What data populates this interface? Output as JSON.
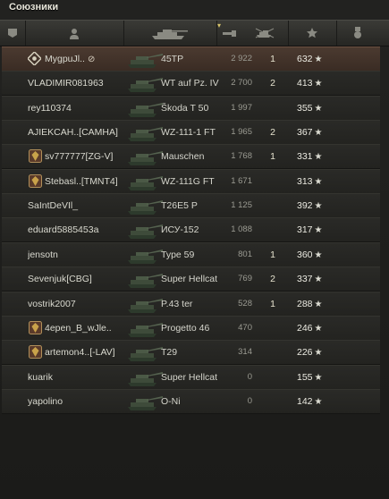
{
  "panel": {
    "title": "Союзники"
  },
  "header": {
    "icons": [
      "platoon-icon",
      "player-icon",
      "tank-icon",
      "sort-arrow-icon",
      "damage-icon",
      "kills-icon",
      "xp-star-icon",
      "medal-icon"
    ]
  },
  "players": [
    {
      "name": "MygpuJl..",
      "tank": "45TP",
      "damage": "2 922",
      "kills": "1",
      "xp": "632",
      "highlight": true,
      "dead": true,
      "icon": "platoon-icon"
    },
    {
      "name": "VLADIMIR081963",
      "tank": "WT auf Pz. IV",
      "damage": "2 700",
      "kills": "2",
      "xp": "413"
    },
    {
      "name": "rey110374",
      "tank": "Škoda T 50",
      "damage": "1 997",
      "kills": "",
      "xp": "355"
    },
    {
      "name": "AJIEKCAH..[CAMHA]",
      "tank": "WZ-111-1 FT",
      "damage": "1 965",
      "kills": "2",
      "xp": "367"
    },
    {
      "name": "sv777777[ZG-V]",
      "tank": "Mauschen",
      "damage": "1 768",
      "kills": "1",
      "xp": "331",
      "icon": "clan-emblem-icon"
    },
    {
      "name": "Stebasl..[TMNT4]",
      "tank": "WZ-111G FT",
      "damage": "1 671",
      "kills": "",
      "xp": "313",
      "icon": "clan-emblem-icon"
    },
    {
      "name": "SaIntDeVIl_",
      "tank": "T26E5 P",
      "damage": "1 125",
      "kills": "",
      "xp": "392"
    },
    {
      "name": "eduard5885453a",
      "tank": "ИСУ-152",
      "damage": "1 088",
      "kills": "",
      "xp": "317"
    },
    {
      "name": "jensotn",
      "tank": "Type 59",
      "damage": "801",
      "kills": "1",
      "xp": "360"
    },
    {
      "name": "Sevenjuk[CBG]",
      "tank": "Super Hellcat",
      "damage": "769",
      "kills": "2",
      "xp": "337"
    },
    {
      "name": "vostrik2007",
      "tank": "P.43 ter",
      "damage": "528",
      "kills": "1",
      "xp": "288"
    },
    {
      "name": "4epen_B_wJle..",
      "tank": "Progetto 46",
      "damage": "470",
      "kills": "",
      "xp": "246",
      "icon": "clan-emblem-icon"
    },
    {
      "name": "artemon4..[-LAV]",
      "tank": "T29",
      "damage": "314",
      "kills": "",
      "xp": "226",
      "icon": "clan-emblem-icon"
    },
    {
      "name": "kuarik",
      "tank": "Super Hellcat",
      "damage": "0",
      "kills": "",
      "xp": "155"
    },
    {
      "name": "yapolino",
      "tank": "O-Ni",
      "damage": "0",
      "kills": "",
      "xp": "142"
    }
  ]
}
